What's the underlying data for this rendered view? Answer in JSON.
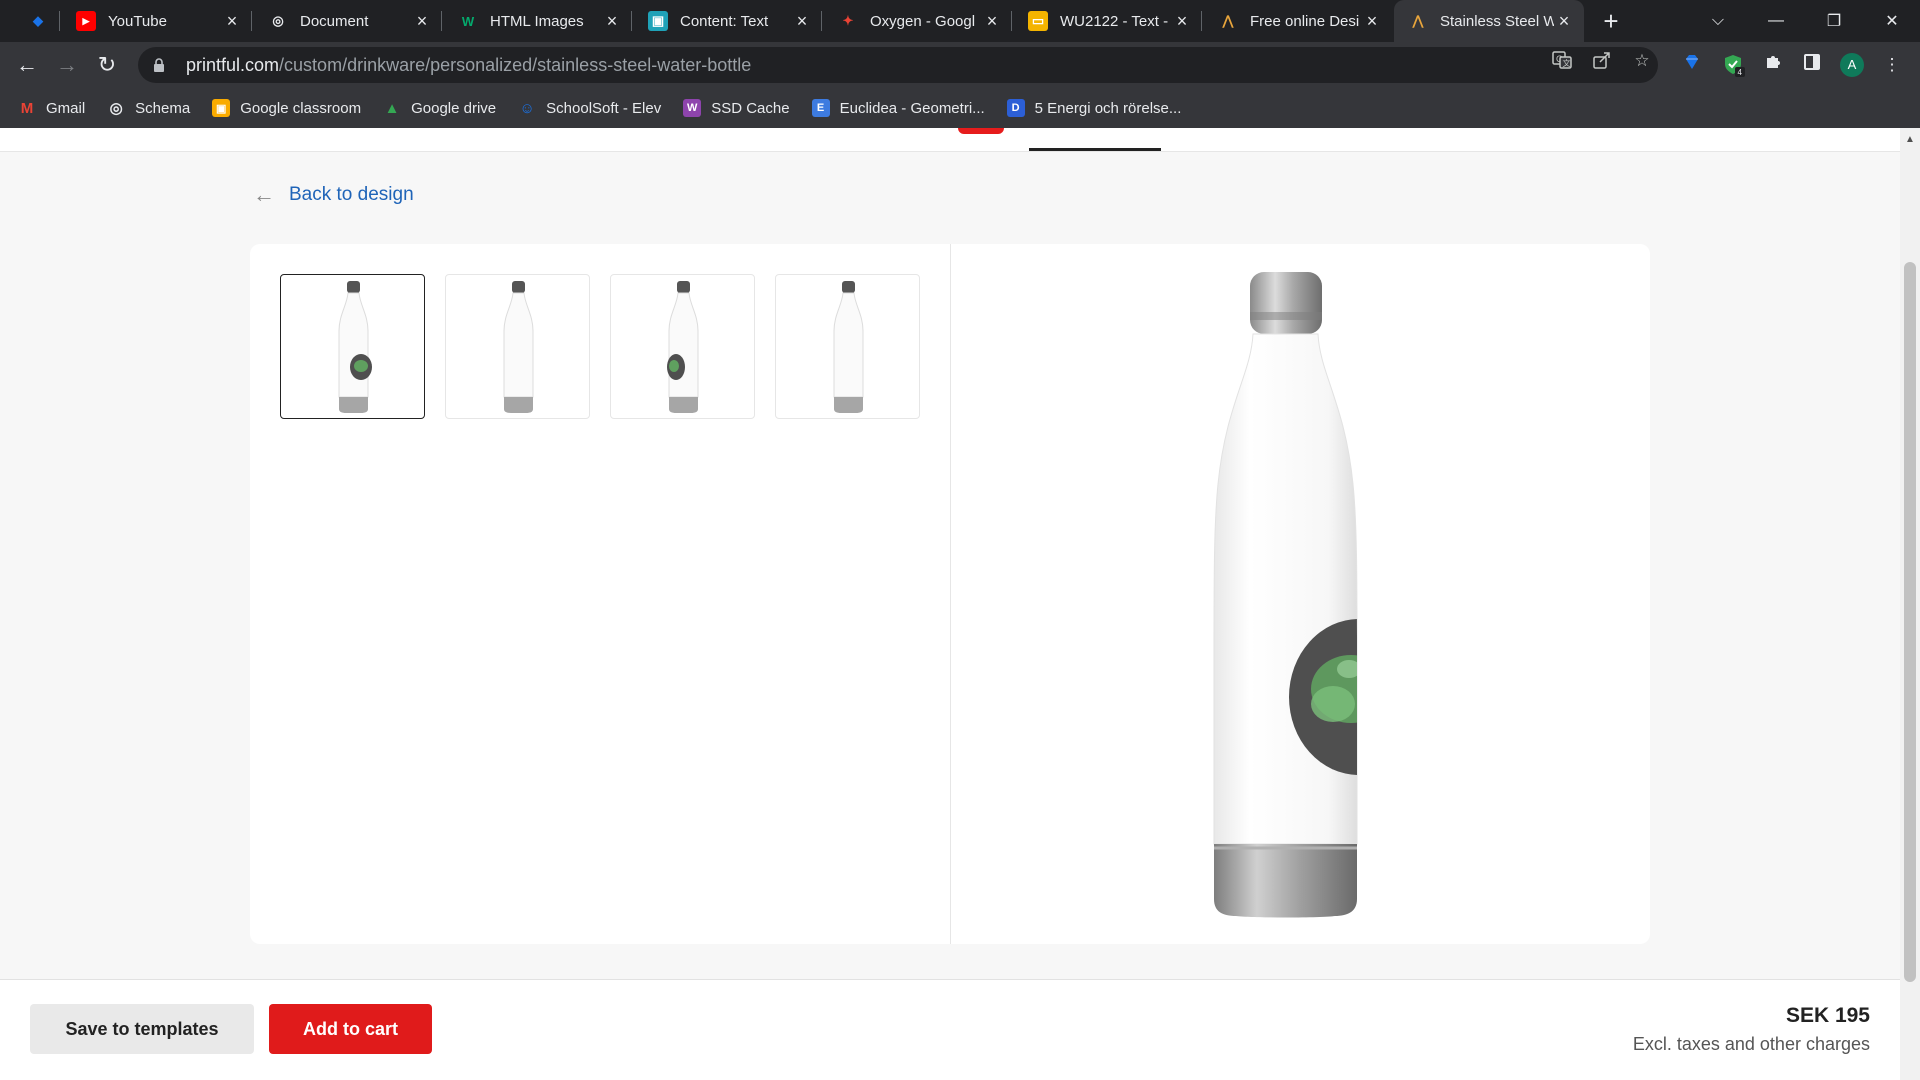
{
  "browser": {
    "tabs": [
      {
        "title": "",
        "icon": "gem-icon",
        "color": "#1a73e8"
      },
      {
        "title": "YouTube",
        "icon": "youtube-icon",
        "color": "#ff0000"
      },
      {
        "title": "Document",
        "icon": "globe-icon",
        "color": "#e8eaed"
      },
      {
        "title": "HTML Images",
        "icon": "w3schools-icon",
        "color": "#04aa6d"
      },
      {
        "title": "Content: Text",
        "icon": "classroom-icon",
        "color": "#1fa2b8"
      },
      {
        "title": "Oxygen - Googl",
        "icon": "google-shapes-icon",
        "color": "#ea4335"
      },
      {
        "title": "WU2122 - Text -",
        "icon": "slides-icon",
        "color": "#f4b400"
      },
      {
        "title": "Free online Desi",
        "icon": "printful-icon",
        "color": "#e8eaed"
      },
      {
        "title": "Stainless Steel W",
        "icon": "printful-icon",
        "color": "#e8eaed",
        "active": true
      }
    ],
    "url_host": "printful.com",
    "url_path": "/custom/drinkware/personalized/stainless-steel-water-bottle",
    "profile_initial": "A",
    "extension_badge": "4",
    "bookmarks": [
      {
        "label": "Gmail",
        "icon": "gmail-icon",
        "color": "#ea4335"
      },
      {
        "label": "Schema",
        "icon": "globe-icon",
        "color": "#e8eaed"
      },
      {
        "label": "Google classroom",
        "icon": "classroom-icon",
        "color": "#f9ab00"
      },
      {
        "label": "Google drive",
        "icon": "drive-icon",
        "color": "#34a853"
      },
      {
        "label": "SchoolSoft - Elev",
        "icon": "schoolsoft-icon",
        "color": "#1a73e8"
      },
      {
        "label": "SSD Cache",
        "icon": "we-icon",
        "color": "#8e44ad"
      },
      {
        "label": "Euclidea - Geometri...",
        "icon": "euclidea-icon",
        "color": "#3d7be0"
      },
      {
        "label": "5 Energi och rörelse...",
        "icon": "d-icon",
        "color": "#2c5fd6"
      }
    ]
  },
  "page": {
    "back_label": "Back to design",
    "thumbnails": [
      {
        "label": "front-view",
        "print": "front",
        "selected": true
      },
      {
        "label": "side-view",
        "print": "none",
        "selected": false
      },
      {
        "label": "left-view",
        "print": "left",
        "selected": false
      },
      {
        "label": "back-view",
        "print": "none",
        "selected": false
      }
    ],
    "footer": {
      "save_label": "Save to templates",
      "cart_label": "Add to cart",
      "price": "SEK 195",
      "price_note": "Excl. taxes and other charges"
    }
  },
  "colors": {
    "accent_red": "#e01b1b",
    "link_blue": "#1f64b8",
    "print_dark": "#4f4f4f",
    "print_green": "#5fa05f"
  }
}
